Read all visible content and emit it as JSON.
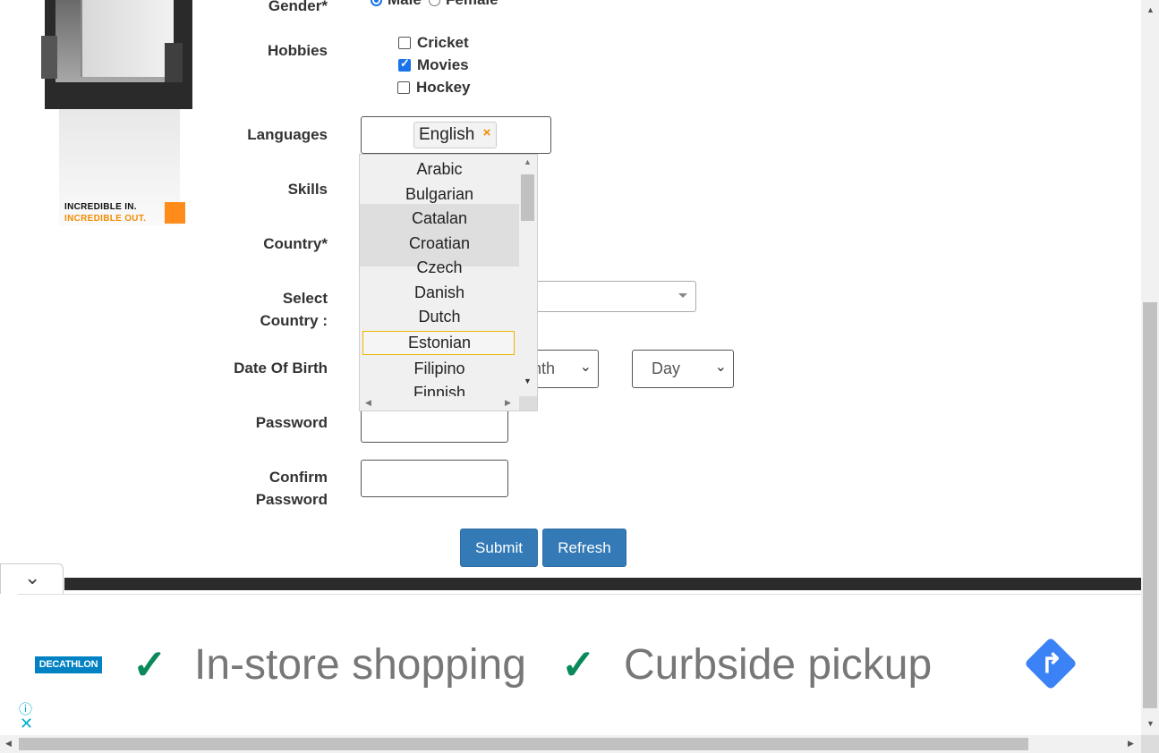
{
  "ad_left": {
    "line1": "INCREDIBLE IN.",
    "line2": "INCREDIBLE OUT."
  },
  "form": {
    "gender_label": "Gender*",
    "gender_options": [
      "Male",
      "Female"
    ],
    "hobbies_label": "Hobbies",
    "hobbies": [
      {
        "label": "Cricket",
        "checked": false
      },
      {
        "label": "Movies",
        "checked": true
      },
      {
        "label": "Hockey",
        "checked": false
      }
    ],
    "languages_label": "Languages",
    "selected_language": "English",
    "tag_remove": "×",
    "skills_label": "Skills",
    "country_label": "Country*",
    "select_country_label_1": "Select",
    "select_country_label_2": "Country :",
    "dob_label": "Date Of Birth",
    "month_placeholder": "Month",
    "month_visible": "nth",
    "day_placeholder": "Day",
    "password_label": "Password",
    "confirm_label_1": "Confirm",
    "confirm_label_2": "Password",
    "submit": "Submit",
    "refresh": "Refresh"
  },
  "language_dropdown": {
    "items": [
      "Arabic",
      "Bulgarian",
      "Catalan",
      "Croatian",
      "Czech",
      "Danish",
      "Dutch",
      "Estonian",
      "Filipino",
      "Finnish"
    ],
    "highlighted": [
      "Catalan",
      "Croatian"
    ],
    "focused": "Estonian"
  },
  "ad_bottom": {
    "brand": "DECATHLON",
    "check_glyph": "✓",
    "feature1": "In-store shopping",
    "feature2": "Curbside pickup",
    "info_glyph": "ⓘ",
    "close_glyph": "✕"
  },
  "colors": {
    "primary_button": "#337ab7",
    "accent_orange": "#f28c00",
    "check_green": "#0a8a5a",
    "nav_blue": "#3b82f6"
  }
}
